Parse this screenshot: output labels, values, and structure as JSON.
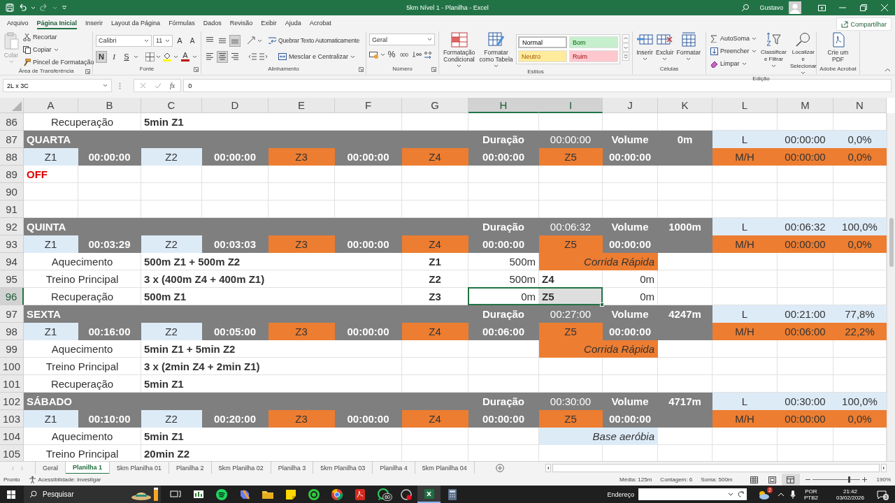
{
  "title_bar": {
    "title": "5km Nível 1 - Planilha - Excel",
    "user": "Gustavo"
  },
  "menu_tabs": [
    {
      "label": "Arquivo",
      "selected": false
    },
    {
      "label": "Página Inicial",
      "selected": true
    },
    {
      "label": "Inserir",
      "selected": false
    },
    {
      "label": "Layout da Página",
      "selected": false
    },
    {
      "label": "Fórmulas",
      "selected": false
    },
    {
      "label": "Dados",
      "selected": false
    },
    {
      "label": "Revisão",
      "selected": false
    },
    {
      "label": "Exibir",
      "selected": false
    },
    {
      "label": "Ajuda",
      "selected": false
    },
    {
      "label": "Acrobat",
      "selected": false
    }
  ],
  "share_button": "Compartilhar",
  "ribbon": {
    "clipboard": {
      "label": "Área de Transferência",
      "paste": {
        "label": "Colar",
        "disabled": true
      },
      "actions": [
        "Recortar",
        "Copiar",
        "Pincel de Formatação"
      ]
    },
    "font": {
      "label": "Fonte",
      "family": "Calibri",
      "size": "11",
      "grow": "A",
      "shrink": "A",
      "styles": [
        {
          "label": "N",
          "selected": true
        },
        {
          "label": "I",
          "selected": false
        },
        {
          "label": "S",
          "selected": false
        }
      ],
      "color_button": "A"
    },
    "alignment": {
      "label": "Alinhamento",
      "vertical": [
        {
          "selected": false
        },
        {
          "selected": false
        },
        {
          "selected": true
        }
      ],
      "horizontal": [
        {
          "selected": false
        },
        {
          "selected": true
        },
        {
          "selected": false
        }
      ],
      "wrap": "Quebrar Texto Automaticamente",
      "merge": "Mesclar e Centralizar"
    },
    "number": {
      "label": "Número",
      "format": "Geral",
      "percent": "%",
      "thousands": "000"
    },
    "styles": {
      "label": "Estilos",
      "conditional": "Formatação Condicional",
      "table": "Formatar como Tabela",
      "gallery": [
        {
          "name": "Normal",
          "color": "#ffffff"
        },
        {
          "name": "Bom",
          "color": "#c6efce"
        },
        {
          "name": "Neutro",
          "color": "#ffeb9c"
        },
        {
          "name": "Ruim",
          "color": "#ffc7ce"
        }
      ]
    },
    "cells": {
      "label": "Células",
      "actions": [
        "Inserir",
        "Excluir",
        "Formatar"
      ]
    },
    "editing": {
      "label": "Edição",
      "small": [
        "AutoSoma",
        "Preencher",
        "Limpar"
      ],
      "large": [
        "Classificar e Filtrar",
        "Localizar e Selecionar"
      ]
    },
    "acrobat": {
      "label": "Adobe Acrobat",
      "action": "Crie um PDF"
    }
  },
  "formula_bar": {
    "name_box": "2L x 3C",
    "fx": "fx",
    "value": "0"
  },
  "columns": [
    {
      "label": "A",
      "selected": false
    },
    {
      "label": "B",
      "selected": false
    },
    {
      "label": "C",
      "selected": false
    },
    {
      "label": "D",
      "selected": false
    },
    {
      "label": "E",
      "selected": false
    },
    {
      "label": "F",
      "selected": false
    },
    {
      "label": "G",
      "selected": false
    },
    {
      "label": "H",
      "selected": true
    },
    {
      "label": "I",
      "selected": true
    },
    {
      "label": "J",
      "selected": false
    },
    {
      "label": "K",
      "selected": false
    },
    {
      "label": "L",
      "selected": false
    },
    {
      "label": "M",
      "selected": false
    },
    {
      "label": "N",
      "selected": false
    }
  ],
  "rows": [
    {
      "number": "86",
      "selected": false,
      "cells": [
        {
          "text": "Recuperação",
          "kind": "label"
        },
        {
          "kind": "merged"
        },
        {
          "text": "5min Z1",
          "kind": "plan"
        },
        {
          "kind": "merged"
        },
        {
          "kind": "merged"
        },
        {
          "kind": "merged"
        }
      ]
    },
    {
      "number": "87",
      "selected": false,
      "cells": [
        {
          "text": "QUARTA",
          "kind": "day"
        },
        {
          "kind": "merged"
        },
        {
          "kind": "merged"
        },
        {
          "kind": "merged"
        },
        {
          "kind": "merged"
        },
        {
          "kind": "merged"
        },
        {
          "kind": "merged"
        },
        {
          "text": "Duração",
          "kind": "day_label"
        },
        {
          "text": "00:00:00",
          "kind": "day_value"
        },
        {
          "text": "Volume",
          "kind": "day_label"
        },
        {
          "text": "0m",
          "kind": "day_label"
        },
        {
          "text": "L",
          "kind": "zone"
        },
        {
          "text": "00:00:00",
          "kind": "zone"
        },
        {
          "text": "0,0%",
          "kind": "zone"
        }
      ]
    },
    {
      "number": "88",
      "selected": false,
      "cells": [
        {
          "text": "Z1",
          "kind": "zone"
        },
        {
          "text": "00:00:00",
          "kind": "time"
        },
        {
          "text": "Z2",
          "kind": "zone"
        },
        {
          "text": "00:00:00",
          "kind": "time"
        },
        {
          "text": "Z3",
          "kind": "hot"
        },
        {
          "text": "00:00:00",
          "kind": "time"
        },
        {
          "text": "Z4",
          "kind": "hot"
        },
        {
          "text": "00:00:00",
          "kind": "time"
        },
        {
          "text": "Z5",
          "kind": "hot"
        },
        {
          "text": "00:00:00",
          "kind": "time"
        },
        {
          "kind": "time"
        },
        {
          "text": "M/H",
          "kind": "hot"
        },
        {
          "text": "00:00:00",
          "kind": "hot"
        },
        {
          "text": "0,0%",
          "kind": "hot"
        }
      ]
    },
    {
      "number": "89",
      "selected": false,
      "cells": [
        {
          "text": "OFF",
          "kind": "alert"
        }
      ]
    },
    {
      "number": "90",
      "selected": false,
      "cells": []
    },
    {
      "number": "91",
      "selected": false,
      "cells": []
    },
    {
      "number": "92",
      "selected": false,
      "cells": [
        {
          "text": "QUINTA",
          "kind": "day"
        },
        {
          "kind": "merged"
        },
        {
          "kind": "merged"
        },
        {
          "kind": "merged"
        },
        {
          "kind": "merged"
        },
        {
          "kind": "merged"
        },
        {
          "kind": "merged"
        },
        {
          "text": "Duração",
          "kind": "day_label"
        },
        {
          "text": "00:06:32",
          "kind": "day_value"
        },
        {
          "text": "Volume",
          "kind": "day_label"
        },
        {
          "text": "1000m",
          "kind": "day_label"
        },
        {
          "text": "L",
          "kind": "zone"
        },
        {
          "text": "00:06:32",
          "kind": "zone"
        },
        {
          "text": "100,0%",
          "kind": "zone"
        }
      ]
    },
    {
      "number": "93",
      "selected": false,
      "cells": [
        {
          "text": "Z1",
          "kind": "zone"
        },
        {
          "text": "00:03:29",
          "kind": "time"
        },
        {
          "text": "Z2",
          "kind": "zone"
        },
        {
          "text": "00:03:03",
          "kind": "time"
        },
        {
          "text": "Z3",
          "kind": "hot"
        },
        {
          "text": "00:00:00",
          "kind": "time"
        },
        {
          "text": "Z4",
          "kind": "hot"
        },
        {
          "text": "00:00:00",
          "kind": "time"
        },
        {
          "text": "Z5",
          "kind": "hot"
        },
        {
          "text": "00:00:00",
          "kind": "time"
        },
        {
          "kind": "time"
        },
        {
          "text": "M/H",
          "kind": "hot"
        },
        {
          "text": "00:00:00",
          "kind": "hot"
        },
        {
          "text": "0,0%",
          "kind": "hot"
        }
      ]
    },
    {
      "number": "94",
      "selected": false,
      "cells": [
        {
          "text": "Aquecimento",
          "kind": "label"
        },
        {
          "kind": "merged"
        },
        {
          "text": "500m Z1 + 500m Z2",
          "kind": "plan"
        },
        {
          "kind": "merged"
        },
        {
          "kind": "merged"
        },
        {
          "kind": "merged"
        },
        {
          "text": "Z1",
          "kind": "zone_tag"
        },
        {
          "text": "500m",
          "kind": "amount"
        },
        {
          "text": "Corrida Rápida",
          "kind": "hot_note"
        },
        {
          "kind": "merged"
        }
      ]
    },
    {
      "number": "95",
      "selected": false,
      "cells": [
        {
          "text": "Treino Principal",
          "kind": "label"
        },
        {
          "kind": "merged"
        },
        {
          "text": "3 x (400m Z4 + 400m Z1)",
          "kind": "plan"
        },
        {
          "kind": "merged"
        },
        {
          "kind": "merged"
        },
        {
          "kind": "merged"
        },
        {
          "text": "Z2",
          "kind": "zone_tag"
        },
        {
          "text": "500m",
          "kind": "amount"
        },
        {
          "text": "Z4",
          "kind": "zone_mark"
        },
        {
          "text": "0m",
          "kind": "amount"
        }
      ]
    },
    {
      "number": "96",
      "selected": true,
      "cells": [
        {
          "text": "Recuperação",
          "kind": "label"
        },
        {
          "kind": "merged"
        },
        {
          "text": "500m Z1",
          "kind": "plan"
        },
        {
          "kind": "merged"
        },
        {
          "kind": "merged"
        },
        {
          "kind": "merged"
        },
        {
          "text": "Z3",
          "kind": "zone_tag"
        },
        {
          "text": "0m",
          "kind": "amount"
        },
        {
          "text": "Z5",
          "kind": "zone_mark"
        },
        {
          "text": "0m",
          "kind": "amount"
        }
      ]
    },
    {
      "number": "97",
      "selected": false,
      "cells": [
        {
          "text": "SEXTA",
          "kind": "day"
        },
        {
          "kind": "merged"
        },
        {
          "kind": "merged"
        },
        {
          "kind": "merged"
        },
        {
          "kind": "merged"
        },
        {
          "kind": "merged"
        },
        {
          "kind": "merged"
        },
        {
          "text": "Duração",
          "kind": "day_label"
        },
        {
          "text": "00:27:00",
          "kind": "day_value"
        },
        {
          "text": "Volume",
          "kind": "day_label"
        },
        {
          "text": "4247m",
          "kind": "day_label"
        },
        {
          "text": "L",
          "kind": "zone"
        },
        {
          "text": "00:21:00",
          "kind": "zone"
        },
        {
          "text": "77,8%",
          "kind": "zone"
        }
      ]
    },
    {
      "number": "98",
      "selected": false,
      "cells": [
        {
          "text": "Z1",
          "kind": "zone"
        },
        {
          "text": "00:16:00",
          "kind": "time"
        },
        {
          "text": "Z2",
          "kind": "zone"
        },
        {
          "text": "00:05:00",
          "kind": "time"
        },
        {
          "text": "Z3",
          "kind": "hot"
        },
        {
          "text": "00:00:00",
          "kind": "time"
        },
        {
          "text": "Z4",
          "kind": "hot"
        },
        {
          "text": "00:06:00",
          "kind": "time"
        },
        {
          "text": "Z5",
          "kind": "hot"
        },
        {
          "text": "00:00:00",
          "kind": "time"
        },
        {
          "kind": "time"
        },
        {
          "text": "M/H",
          "kind": "hot"
        },
        {
          "text": "00:06:00",
          "kind": "hot"
        },
        {
          "text": "22,2%",
          "kind": "hot"
        }
      ]
    },
    {
      "number": "99",
      "selected": false,
      "cells": [
        {
          "text": "Aquecimento",
          "kind": "label"
        },
        {
          "kind": "merged"
        },
        {
          "text": "5min Z1 + 5min Z2",
          "kind": "plan"
        },
        {
          "kind": "merged"
        },
        {
          "kind": "merged"
        },
        {
          "kind": "merged"
        },
        {
          "kind": "empty"
        },
        {
          "kind": "empty"
        },
        {
          "text": "Corrida Rápida",
          "kind": "hot_note"
        },
        {
          "kind": "merged"
        }
      ]
    },
    {
      "number": "100",
      "selected": false,
      "cells": [
        {
          "text": "Treino Principal",
          "kind": "label"
        },
        {
          "kind": "merged"
        },
        {
          "text": "3 x (2min Z4 + 2min Z1)",
          "kind": "plan"
        },
        {
          "kind": "merged"
        },
        {
          "kind": "merged"
        },
        {
          "kind": "merged"
        }
      ]
    },
    {
      "number": "101",
      "selected": false,
      "cells": [
        {
          "text": "Recuperação",
          "kind": "label"
        },
        {
          "kind": "merged"
        },
        {
          "text": "5min Z1",
          "kind": "plan"
        },
        {
          "kind": "merged"
        },
        {
          "kind": "merged"
        },
        {
          "kind": "merged"
        }
      ]
    },
    {
      "number": "102",
      "selected": false,
      "cells": [
        {
          "text": "SÁBADO",
          "kind": "day"
        },
        {
          "kind": "merged"
        },
        {
          "kind": "merged"
        },
        {
          "kind": "merged"
        },
        {
          "kind": "merged"
        },
        {
          "kind": "merged"
        },
        {
          "kind": "merged"
        },
        {
          "text": "Duração",
          "kind": "day_label"
        },
        {
          "text": "00:30:00",
          "kind": "day_value"
        },
        {
          "text": "Volume",
          "kind": "day_label"
        },
        {
          "text": "4717m",
          "kind": "day_label"
        },
        {
          "text": "L",
          "kind": "zone"
        },
        {
          "text": "00:30:00",
          "kind": "zone"
        },
        {
          "text": "100,0%",
          "kind": "zone"
        }
      ]
    },
    {
      "number": "103",
      "selected": false,
      "cells": [
        {
          "text": "Z1",
          "kind": "zone"
        },
        {
          "text": "00:10:00",
          "kind": "time"
        },
        {
          "text": "Z2",
          "kind": "zone"
        },
        {
          "text": "00:20:00",
          "kind": "time"
        },
        {
          "text": "Z3",
          "kind": "hot"
        },
        {
          "text": "00:00:00",
          "kind": "time"
        },
        {
          "text": "Z4",
          "kind": "hot"
        },
        {
          "text": "00:00:00",
          "kind": "time"
        },
        {
          "text": "Z5",
          "kind": "hot"
        },
        {
          "text": "00:00:00",
          "kind": "time"
        },
        {
          "kind": "time"
        },
        {
          "text": "M/H",
          "kind": "hot"
        },
        {
          "text": "00:00:00",
          "kind": "hot"
        },
        {
          "text": "0,0%",
          "kind": "hot"
        }
      ]
    },
    {
      "number": "104",
      "selected": false,
      "cells": [
        {
          "text": "Aquecimento",
          "kind": "label"
        },
        {
          "kind": "merged"
        },
        {
          "text": "5min Z1",
          "kind": "plan"
        },
        {
          "kind": "merged"
        },
        {
          "kind": "merged"
        },
        {
          "kind": "merged"
        },
        {
          "kind": "empty"
        },
        {
          "kind": "empty"
        },
        {
          "text": "Base aeróbia",
          "kind": "cool_note"
        },
        {
          "kind": "merged"
        }
      ]
    },
    {
      "number": "105",
      "selected": false,
      "cells": [
        {
          "text": "Treino Principal",
          "kind": "label"
        },
        {
          "kind": "merged"
        },
        {
          "text": "20min Z2",
          "kind": "plan"
        },
        {
          "kind": "merged"
        },
        {
          "kind": "merged"
        },
        {
          "kind": "merged"
        }
      ]
    }
  ],
  "sheet_tabs": [
    {
      "label": "Geral",
      "selected": false
    },
    {
      "label": "Planilha 1",
      "selected": true
    },
    {
      "label": "5km Planilha 01",
      "selected": false
    },
    {
      "label": "Planilha 2",
      "selected": false
    },
    {
      "label": "5km Planilha 02",
      "selected": false
    },
    {
      "label": "Planilha 3",
      "selected": false
    },
    {
      "label": "5km Planilha 03",
      "selected": false
    },
    {
      "label": "Planilha 4",
      "selected": false
    },
    {
      "label": "5km Planilha 04",
      "selected": false
    }
  ],
  "status_bar": {
    "mode": "Pronto",
    "accessibility": "Acessibilidade: investigar",
    "stats": [
      "Média: 125m",
      "Contagem: 6",
      "Soma: 500m"
    ],
    "views": [
      {
        "selected": false
      },
      {
        "selected": false
      },
      {
        "selected": true
      }
    ],
    "zoom": {
      "level": 0.77,
      "reading": "190%"
    }
  },
  "taskbar": {
    "search": "Pesquisar",
    "apps": [
      {
        "selected": false
      },
      {
        "selected": false
      },
      {
        "selected": false
      },
      {
        "selected": false
      },
      {
        "selected": false
      },
      {
        "selected": false
      },
      {
        "selected": false
      },
      {
        "selected": false
      },
      {
        "selected": false
      },
      {
        "selected": false,
        "badge": "60"
      },
      {
        "selected": false
      },
      {
        "selected": true
      },
      {
        "selected": false
      }
    ],
    "address_label": "Endereço",
    "weather_badge": "2",
    "language": "POR",
    "layout": "PTB2",
    "time": "21:42",
    "date": "03/02/2026",
    "notifications": "3"
  }
}
